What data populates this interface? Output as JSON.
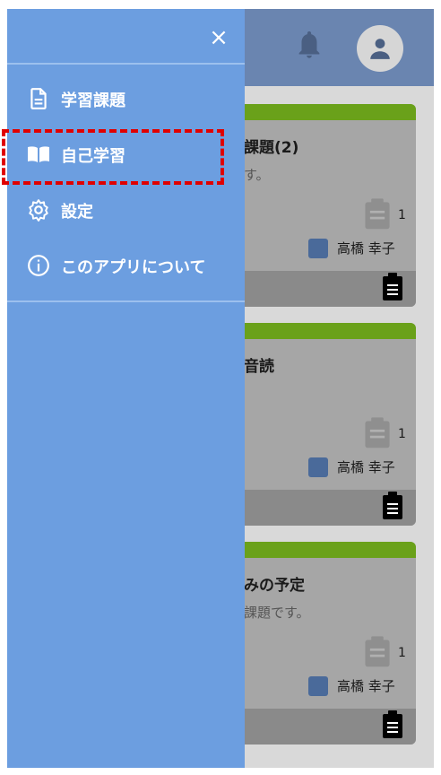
{
  "drawer": {
    "close_icon": "×",
    "items": [
      {
        "label": "学習課題",
        "icon": "document-icon"
      },
      {
        "label": "自己学習",
        "icon": "book-icon"
      },
      {
        "label": "設定",
        "icon": "gear-icon"
      },
      {
        "label": "このアプリについて",
        "icon": "info-icon"
      }
    ],
    "highlighted_index": 1
  },
  "header": {
    "icons": [
      "bell-icon",
      "account-icon"
    ]
  },
  "cards": [
    {
      "title": "課題(2)",
      "desc": "す。",
      "count": "1",
      "teacher": "高橋 幸子"
    },
    {
      "title": "音読",
      "desc": "",
      "count": "1",
      "teacher": "高橋 幸子"
    },
    {
      "title": "みの予定",
      "desc": "課題です。",
      "count": "1",
      "teacher": "高橋 幸子"
    }
  ],
  "colors": {
    "drawer": "#6c9ee0",
    "appbar": "#6a85b0",
    "card_stripe": "#6aa11a",
    "highlight": "#e00000"
  }
}
